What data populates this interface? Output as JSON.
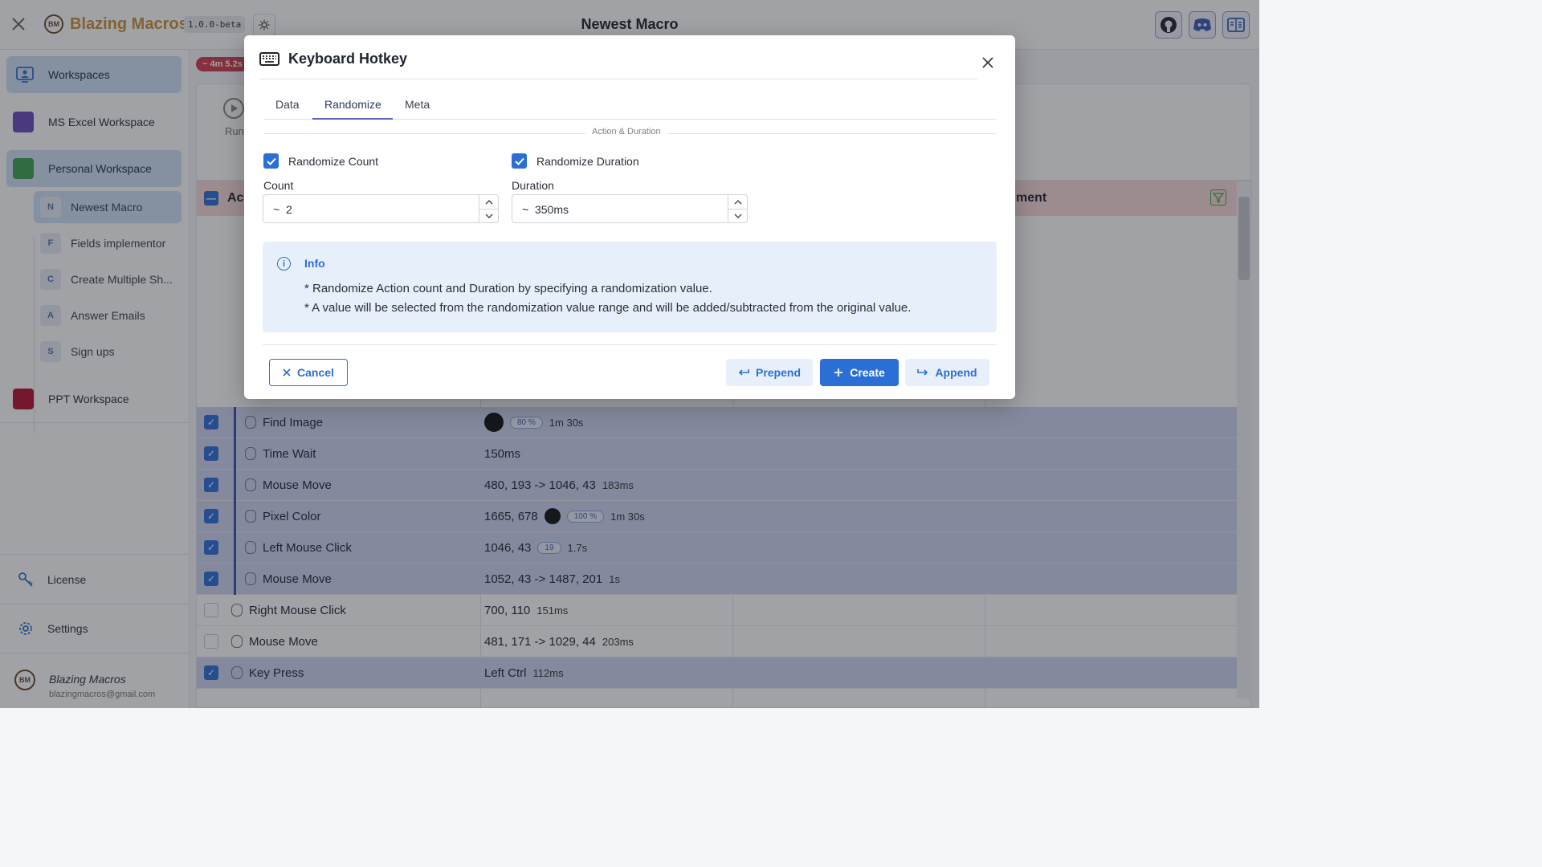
{
  "header": {
    "brand": "Blazing Macros",
    "logo_text": "BM",
    "version": "1.0.0-beta",
    "page_title": "Newest Macro",
    "buttons": [
      "github-icon",
      "discord-icon",
      "docs-icon"
    ]
  },
  "sidebar": {
    "workspaces_label": "Workspaces",
    "items": [
      {
        "label": "MS Excel Workspace",
        "color": "#6b4bbd"
      },
      {
        "label": "Personal Workspace",
        "color": "#3fa34d"
      },
      {
        "label": "PPT Workspace",
        "color": "#b5122d"
      }
    ],
    "macros": [
      {
        "letter": "N",
        "label": "Newest Macro"
      },
      {
        "letter": "F",
        "label": "Fields implementor"
      },
      {
        "letter": "C",
        "label": "Create Multiple Sh..."
      },
      {
        "letter": "A",
        "label": "Answer Emails"
      },
      {
        "letter": "S",
        "label": "Sign ups"
      }
    ],
    "license": "License",
    "settings": "Settings",
    "user_name": "Blazing Macros",
    "user_email": "blazingmacros@gmail.com"
  },
  "main": {
    "timer_badge": "~ 4m 5.2s",
    "run_label": "Run",
    "table_header_action": "Act",
    "table_header_comment": "ment",
    "rows": [
      {
        "name": "Find Image",
        "value": "",
        "badge": "80 %",
        "extra": "1m 30s",
        "selected": true,
        "indent": true,
        "dot": true,
        "dotColor": "#111"
      },
      {
        "name": "Time Wait",
        "value": "150ms",
        "badge": "",
        "extra": "",
        "selected": true,
        "indent": true
      },
      {
        "name": "Mouse Move",
        "value": "480, 193 -> 1046, 43",
        "badge": "",
        "extra": "183ms",
        "selected": true,
        "indent": true
      },
      {
        "name": "Pixel Color",
        "value": "1665, 678",
        "badge": "100 %",
        "extra": "1m 30s",
        "selected": true,
        "indent": true,
        "dot": true
      },
      {
        "name": "Left Mouse Click",
        "value": "1046, 43",
        "badge": "19",
        "extra": "1.7s",
        "selected": true,
        "indent": true
      },
      {
        "name": "Mouse Move",
        "value": "1052, 43 -> 1487, 201",
        "badge": "",
        "extra": "1s",
        "selected": true,
        "indent": true
      },
      {
        "name": "Right Mouse Click",
        "value": "700, 110",
        "badge": "",
        "extra": "151ms",
        "selected": false,
        "indent": false
      },
      {
        "name": "Mouse Move",
        "value": "481, 171 -> 1029, 44",
        "badge": "",
        "extra": "203ms",
        "selected": false,
        "indent": false
      },
      {
        "name": "Key Press",
        "value": "Left Ctrl",
        "badge": "",
        "extra": "112ms",
        "selected": true,
        "indent": false
      }
    ]
  },
  "dialog": {
    "title": "Keyboard Hotkey",
    "tabs": [
      "Data",
      "Randomize",
      "Meta"
    ],
    "active_tab": "Randomize",
    "section_label": "Action & Duration",
    "randomize_count_label": "Randomize Count",
    "randomize_duration_label": "Randomize Duration",
    "count_label": "Count",
    "count_value": "~  2",
    "duration_label": "Duration",
    "duration_value": "~  350ms",
    "info_title": "Info",
    "info_lines": [
      "* Randomize Action count and Duration by specifying a randomization value.",
      "* A value will be selected from the randomization value range and will be added/subtracted from the original value."
    ],
    "cancel_label": "Cancel",
    "prepend_label": "Prepend",
    "create_label": "Create",
    "append_label": "Append"
  },
  "colors": {
    "accent": "#2b6fd6",
    "selected_row": "#cdd4ef",
    "danger_badge": "#d23b4b"
  }
}
